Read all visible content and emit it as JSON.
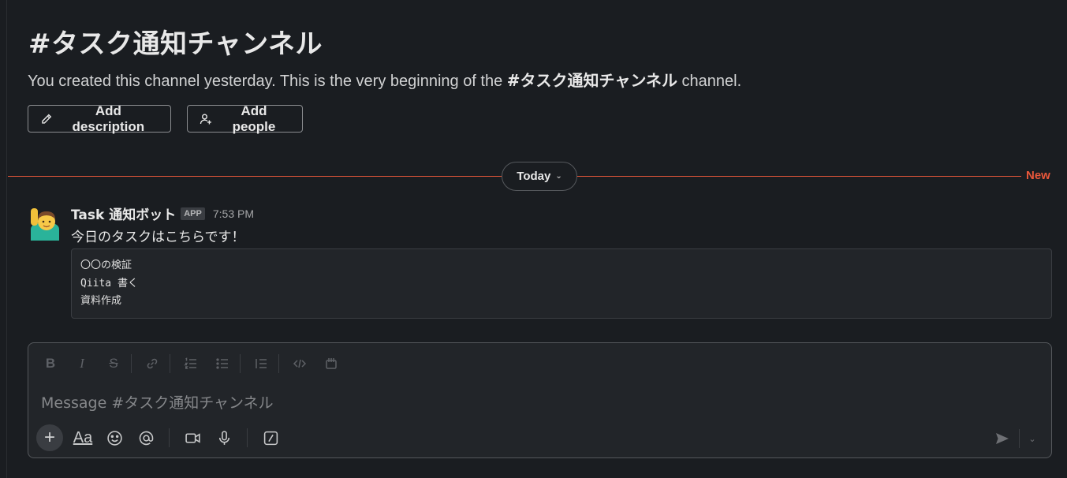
{
  "channel": {
    "title": "#タスク通知チャンネル",
    "intro_before": "You created this channel yesterday. This is the very beginning of the ",
    "intro_channel": "#タスク通知チャンネル",
    "intro_after": " channel."
  },
  "actions": {
    "add_description": "Add description",
    "add_people": "Add people"
  },
  "divider": {
    "date_label": "Today",
    "new_label": "New",
    "new_color": "#e8573a"
  },
  "message": {
    "sender": "Task 通知ボット",
    "badge": "APP",
    "time": "7:53 PM",
    "avatar_emoji": "🙋‍♂️",
    "text": "今日のタスクはこちらです！",
    "code_lines": [
      "〇〇の検証",
      "Qiita 書く",
      "資料作成"
    ]
  },
  "composer": {
    "placeholder": "Message #タスク通知チャンネル",
    "format_icons": [
      "bold-icon",
      "italic-icon",
      "strikethrough-icon",
      "link-icon",
      "ordered-list-icon",
      "bulleted-list-icon",
      "blockquote-icon",
      "code-icon",
      "code-block-icon"
    ],
    "bottom_icons": [
      "plus-icon",
      "formatting-icon",
      "emoji-icon",
      "mention-icon",
      "video-icon",
      "microphone-icon",
      "slash-command-icon"
    ],
    "formatting_label": "Aa"
  }
}
